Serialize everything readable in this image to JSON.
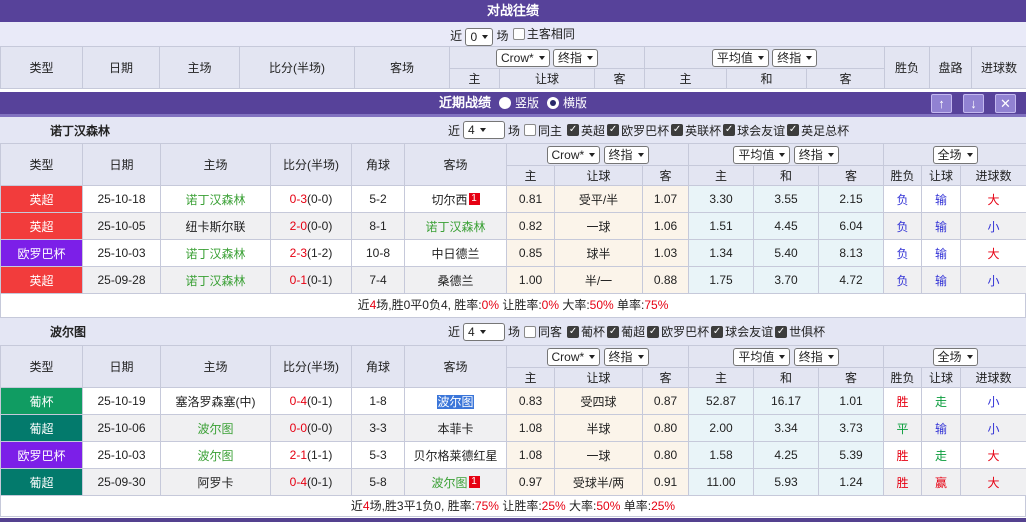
{
  "colors": {
    "accent_purple": "#57429a",
    "league_red": "#f23c3c",
    "league_purple": "#7c1fe8",
    "league_green": "#109c62",
    "league_teal": "#037a6c",
    "score_red": "#e60012",
    "team_green": "#3aa035",
    "selection_blue": "#3b76d9",
    "result_blue": "#3434d6",
    "result_green": "#0a9c3c"
  },
  "h2h": {
    "title": "对战往绩",
    "filter": {
      "near_label": "近",
      "recent_value": "0",
      "unit_label": "场",
      "same_label": "主客相同"
    },
    "header": {
      "col_type": "类型",
      "col_date": "日期",
      "col_home": "主场",
      "col_score": "比分(半场)",
      "col_away": "客场",
      "col_result": "胜负",
      "col_trend": "盘路",
      "col_goals": "进球数",
      "odds_group": {
        "select1": "Crow*",
        "select2": "终指",
        "sub": [
          "主",
          "让球",
          "客"
        ]
      },
      "avg_group": {
        "select1": "平均值",
        "select2": "终指",
        "sub": [
          "主",
          "和",
          "客"
        ]
      }
    }
  },
  "recent_bar": {
    "title": "近期战绩",
    "radio_vertical": "竖版",
    "radio_horizontal": "横版",
    "up_icon": "↑",
    "down_icon": "↓",
    "close_icon": "✕"
  },
  "team_header": {
    "col_type": "类型",
    "col_date": "日期",
    "col_home": "主场",
    "col_score": "比分(半场)",
    "col_corner": "角球",
    "col_away": "客场",
    "odds_group": {
      "select1": "Crow*",
      "select2": "终指",
      "sub": [
        "主",
        "让球",
        "客"
      ]
    },
    "avg_group": {
      "select1": "平均值",
      "select2": "终指",
      "sub": [
        "主",
        "和",
        "客"
      ]
    },
    "result_group": {
      "select": "全场",
      "sub": [
        "胜负",
        "让球",
        "进球数"
      ]
    }
  },
  "sections": [
    {
      "team": "诺丁汉森林",
      "filter": {
        "near_label": "近",
        "recent_value": "4",
        "unit_label": "场",
        "same_label": "同主",
        "checks": [
          "英超",
          "欧罗巴杯",
          "英联杯",
          "球会友谊",
          "英足总杯"
        ]
      },
      "rows": [
        {
          "type": {
            "label": "英超",
            "bg": "#f23c3c"
          },
          "date": "25-10-18",
          "home": {
            "name": "诺丁汉森林",
            "green": true
          },
          "score": "0-3",
          "half": "(0-0)",
          "corner": "5-2",
          "away": {
            "name": "切尔西",
            "green": false,
            "sup": "1"
          },
          "odds": [
            "0.81",
            "受平/半",
            "1.07"
          ],
          "avg": [
            "3.30",
            "3.55",
            "2.15"
          ],
          "res": [
            "负",
            "blue"
          ],
          "let": [
            "输",
            "blue"
          ],
          "goal": [
            "大",
            "red"
          ]
        },
        {
          "type": {
            "label": "英超",
            "bg": "#f23c3c"
          },
          "date": "25-10-05",
          "home": {
            "name": "纽卡斯尔联",
            "green": false
          },
          "score": "2-0",
          "half": "(0-0)",
          "corner": "8-1",
          "away": {
            "name": "诺丁汉森林",
            "green": true
          },
          "odds": [
            "0.82",
            "一球",
            "1.06"
          ],
          "avg": [
            "1.51",
            "4.45",
            "6.04"
          ],
          "res": [
            "负",
            "blue"
          ],
          "let": [
            "输",
            "blue"
          ],
          "goal": [
            "小",
            "blue"
          ]
        },
        {
          "type": {
            "label": "欧罗巴杯",
            "bg": "#7c1fe8"
          },
          "date": "25-10-03",
          "home": {
            "name": "诺丁汉森林",
            "green": true
          },
          "score": "2-3",
          "half": "(1-2)",
          "corner": "10-8",
          "away": {
            "name": "中日德兰",
            "green": false
          },
          "odds": [
            "0.85",
            "球半",
            "1.03"
          ],
          "avg": [
            "1.34",
            "5.40",
            "8.13"
          ],
          "res": [
            "负",
            "blue"
          ],
          "let": [
            "输",
            "blue"
          ],
          "goal": [
            "大",
            "red"
          ]
        },
        {
          "type": {
            "label": "英超",
            "bg": "#f23c3c"
          },
          "date": "25-09-28",
          "home": {
            "name": "诺丁汉森林",
            "green": true
          },
          "score": "0-1",
          "half": "(0-1)",
          "corner": "7-4",
          "away": {
            "name": "桑德兰",
            "green": false
          },
          "odds": [
            "1.00",
            "半/一",
            "0.88"
          ],
          "avg": [
            "1.75",
            "3.70",
            "4.72"
          ],
          "res": [
            "负",
            "blue"
          ],
          "let": [
            "输",
            "blue"
          ],
          "goal": [
            "小",
            "blue"
          ]
        }
      ],
      "summary": [
        {
          "t": "近"
        },
        {
          "t": "4",
          "c": "red"
        },
        {
          "t": "场,胜0平0负4, 胜率:"
        },
        {
          "t": "0%",
          "c": "red"
        },
        {
          "t": " 让胜率:"
        },
        {
          "t": "0%",
          "c": "red"
        },
        {
          "t": " 大率:"
        },
        {
          "t": "50%",
          "c": "red"
        },
        {
          "t": " 单率:"
        },
        {
          "t": "75%",
          "c": "red"
        }
      ]
    },
    {
      "team": "波尔图",
      "filter": {
        "near_label": "近",
        "recent_value": "4",
        "unit_label": "场",
        "same_label": "同客",
        "checks": [
          "葡杯",
          "葡超",
          "欧罗巴杯",
          "球会友谊",
          "世俱杯"
        ]
      },
      "rows": [
        {
          "type": {
            "label": "葡杯",
            "bg": "#109c62"
          },
          "date": "25-10-19",
          "home": {
            "name": "塞洛罗森塞(中)",
            "green": false
          },
          "score": "0-4",
          "half": "(0-1)",
          "corner": "1-8",
          "away": {
            "name": "波尔图",
            "green": true,
            "selected": true
          },
          "odds": [
            "0.83",
            "受四球",
            "0.87"
          ],
          "avg": [
            "52.87",
            "16.17",
            "1.01"
          ],
          "res": [
            "胜",
            "red"
          ],
          "let": [
            "走",
            "green"
          ],
          "goal": [
            "小",
            "blue"
          ]
        },
        {
          "type": {
            "label": "葡超",
            "bg": "#037a6c"
          },
          "date": "25-10-06",
          "home": {
            "name": "波尔图",
            "green": true
          },
          "score": "0-0",
          "half": "(0-0)",
          "corner": "3-3",
          "away": {
            "name": "本菲卡",
            "green": false
          },
          "odds": [
            "1.08",
            "半球",
            "0.80"
          ],
          "avg": [
            "2.00",
            "3.34",
            "3.73"
          ],
          "res": [
            "平",
            "green"
          ],
          "let": [
            "输",
            "blue"
          ],
          "goal": [
            "小",
            "blue"
          ]
        },
        {
          "type": {
            "label": "欧罗巴杯",
            "bg": "#7c1fe8"
          },
          "date": "25-10-03",
          "home": {
            "name": "波尔图",
            "green": true
          },
          "score": "2-1",
          "half": "(1-1)",
          "corner": "5-3",
          "away": {
            "name": "贝尔格莱德红星",
            "green": false
          },
          "odds": [
            "1.08",
            "一球",
            "0.80"
          ],
          "avg": [
            "1.58",
            "4.25",
            "5.39"
          ],
          "res": [
            "胜",
            "red"
          ],
          "let": [
            "走",
            "green"
          ],
          "goal": [
            "大",
            "red"
          ]
        },
        {
          "type": {
            "label": "葡超",
            "bg": "#037a6c"
          },
          "date": "25-09-30",
          "home": {
            "name": "阿罗卡",
            "green": false
          },
          "score": "0-4",
          "half": "(0-1)",
          "corner": "5-8",
          "away": {
            "name": "波尔图",
            "green": true,
            "sup": "1"
          },
          "odds": [
            "0.97",
            "受球半/两",
            "0.91"
          ],
          "avg": [
            "11.00",
            "5.93",
            "1.24"
          ],
          "res": [
            "胜",
            "red"
          ],
          "let": [
            "赢",
            "red"
          ],
          "goal": [
            "大",
            "red"
          ]
        }
      ],
      "summary": [
        {
          "t": "近"
        },
        {
          "t": "4",
          "c": "red"
        },
        {
          "t": "场,胜3平1负0, 胜率:"
        },
        {
          "t": "75%",
          "c": "red"
        },
        {
          "t": " 让胜率:"
        },
        {
          "t": "25%",
          "c": "red"
        },
        {
          "t": " 大率:"
        },
        {
          "t": "50%",
          "c": "red"
        },
        {
          "t": " 单率:"
        },
        {
          "t": "25%",
          "c": "red"
        }
      ]
    }
  ]
}
